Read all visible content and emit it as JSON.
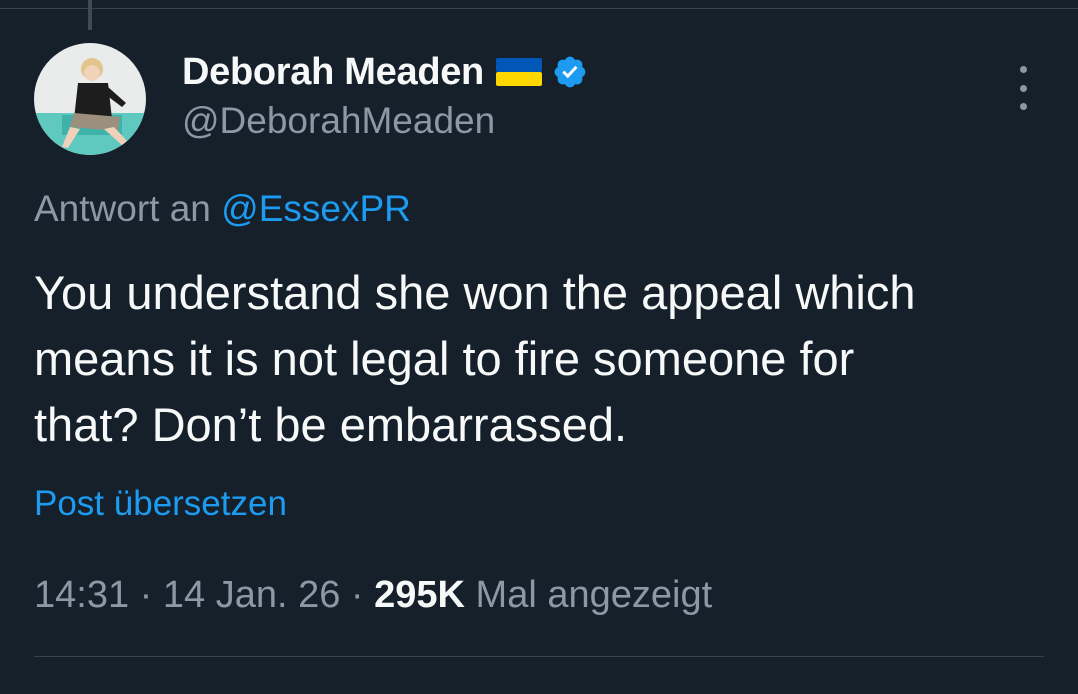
{
  "author": {
    "display_name": "Deborah Meaden",
    "handle": "@DeborahMeaden",
    "flag_icon": "ukraine-flag-icon",
    "verified_icon": "verified-badge-icon",
    "verified_color": "#1d9bf0"
  },
  "reply": {
    "prefix": "Antwort an",
    "mention": "@EssexPR"
  },
  "tweet": {
    "text": "You understand she won the appeal which\nmeans it is not legal to fire someone for\nthat? Don’t be embarrassed."
  },
  "translate_label": "Post übersetzen",
  "meta": {
    "time": "14:31",
    "separator": " · ",
    "date": "14 Jan. 26",
    "views_count": "295K",
    "views_label": "Mal angezeigt"
  },
  "colors": {
    "background": "#15202b",
    "accent": "#1d9bf0",
    "muted": "#8b98a5",
    "text": "#f7f9f9"
  }
}
